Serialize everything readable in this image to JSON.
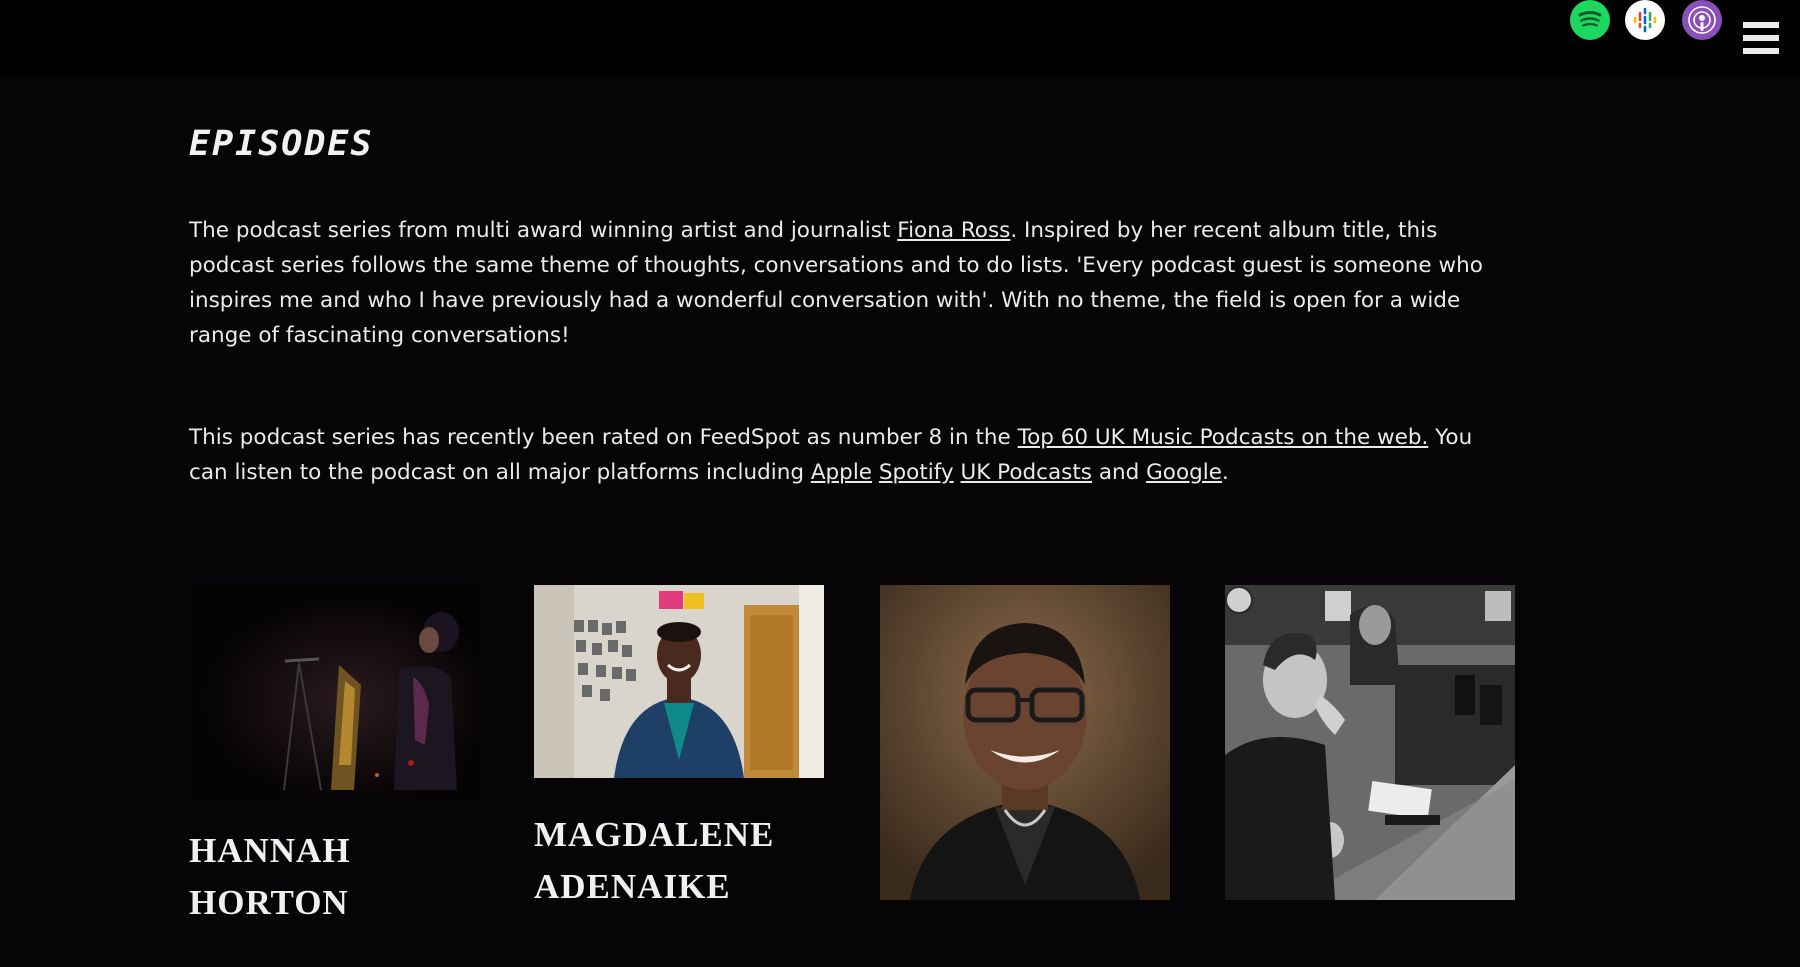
{
  "header": {
    "icons": [
      {
        "name": "spotify-icon",
        "color": "#1ed760"
      },
      {
        "name": "google-podcasts-icon",
        "color": "#ffffff"
      },
      {
        "name": "apple-podcasts-icon",
        "color": "#8a4fb9"
      },
      {
        "name": "hamburger-menu-icon",
        "color": "#eceaea"
      }
    ]
  },
  "main": {
    "title": "EPISODES",
    "intro": {
      "part1": "The podcast series from multi award winning artist and journalist ",
      "link_fiona": "Fiona Ross",
      "part2": ". Inspired by her recent album title, this podcast series follows the same theme of thoughts, conversations and to do lists. 'Every podcast guest is someone who inspires me and who I have previously had a wonderful conversation with'. With no theme, the field is open for a wide range of fascinating conversations!"
    },
    "rating": {
      "part1": "This podcast series has recently been rated on FeedSpot as number 8 in the ",
      "link_top60": "Top 60 UK Music Podcasts on the web.",
      "part2": " You can listen to the podcast on all major platforms including ",
      "link_apple": "Apple",
      "link_spotify": "Spotify",
      "link_ukpodcasts": "UK Podcasts",
      "and_text": " and ",
      "link_google": "Google",
      "period": "."
    },
    "episodes": [
      {
        "name_line1": "HANNAH",
        "name_line2": "HORTON"
      },
      {
        "name_line1": "MAGDALENE",
        "name_line2": "ADENAIKE"
      },
      {
        "name_line1": "",
        "name_line2": ""
      },
      {
        "name_line1": "",
        "name_line2": ""
      }
    ]
  }
}
